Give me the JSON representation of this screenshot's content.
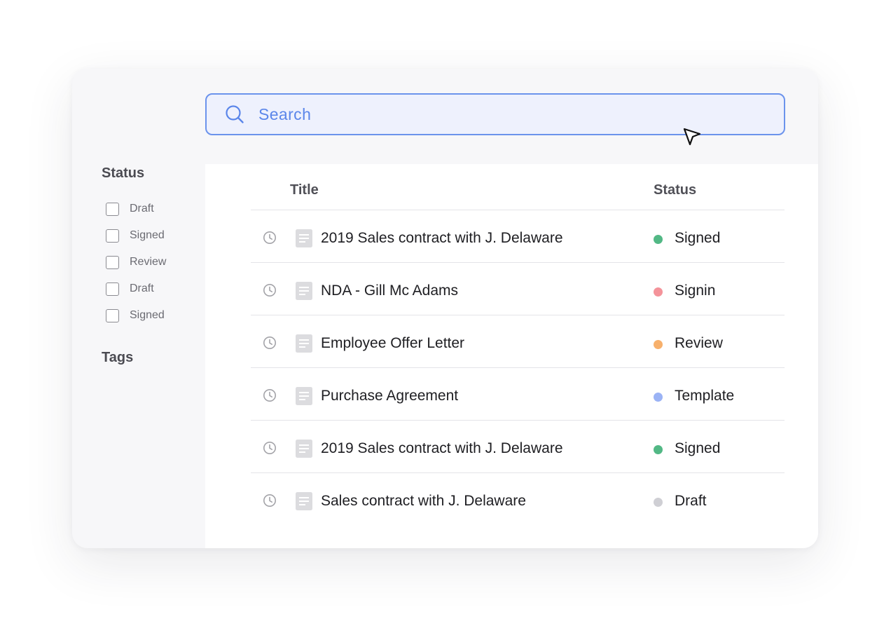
{
  "search": {
    "placeholder": "Search",
    "accent": "#6b93ec",
    "text_color": "#5b86ea"
  },
  "sidebar": {
    "status_title": "Status",
    "filters": [
      {
        "label": "Draft",
        "checked": false
      },
      {
        "label": "Signed",
        "checked": false
      },
      {
        "label": "Review",
        "checked": false
      },
      {
        "label": "Draft",
        "checked": false
      },
      {
        "label": "Signed",
        "checked": false
      }
    ],
    "tags_title": "Tags"
  },
  "table": {
    "columns": {
      "title": "Title",
      "status": "Status"
    },
    "rows": [
      {
        "title": "2019 Sales contract with J. Delaware",
        "status": "Signed",
        "status_color": "#52b885"
      },
      {
        "title": "NDA - Gill Mc Adams",
        "status": "Signin",
        "status_color": "#f4939a"
      },
      {
        "title": "Employee Offer Letter",
        "status": "Review",
        "status_color": "#f7b06c"
      },
      {
        "title": "Purchase Agreement",
        "status": "Template",
        "status_color": "#9bb3f5"
      },
      {
        "title": "2019 Sales contract with J. Delaware",
        "status": "Signed",
        "status_color": "#52b885"
      },
      {
        "title": "Sales contract with J. Delaware",
        "status": "Draft",
        "status_color": "#cfcfd4"
      }
    ]
  },
  "icons": {
    "search": "search-icon",
    "cursor": "mouse-pointer-icon",
    "row_time": "clock-icon",
    "row_doc": "document-icon"
  }
}
